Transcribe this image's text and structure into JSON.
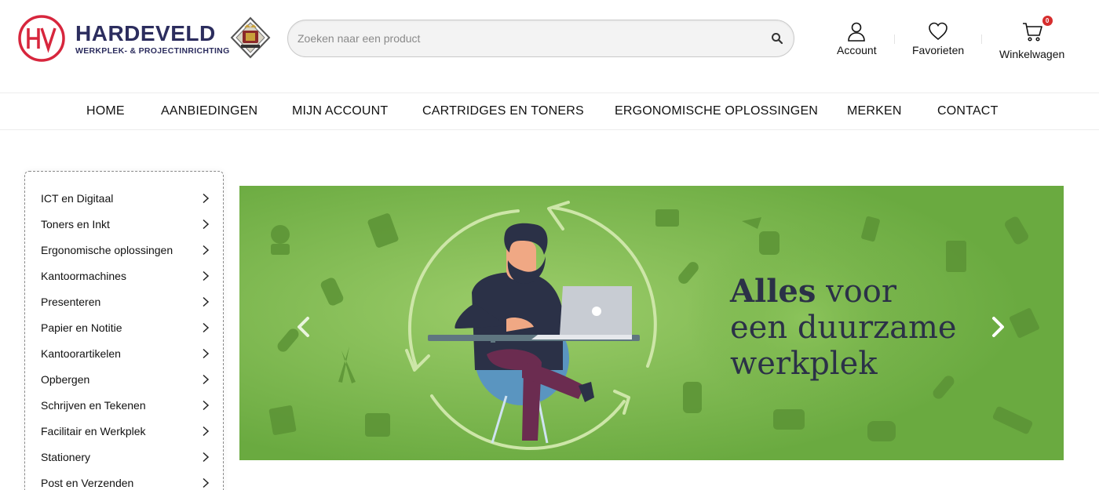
{
  "brand": {
    "name": "HARDEVELD",
    "tagline": "WERKPLEK- & PROJECTINRICHTING",
    "monogram": "HV",
    "color": "#2c2d5e",
    "accent": "#d7263d"
  },
  "search": {
    "placeholder": "Zoeken naar een product",
    "icon": "search-icon"
  },
  "header_actions": {
    "account": "Account",
    "favorites": "Favorieten",
    "cart": "Winkelwagen",
    "cart_count": "0"
  },
  "nav": [
    "HOME",
    "AANBIEDINGEN",
    "MIJN ACCOUNT",
    "CARTRIDGES EN TONERS",
    "ERGONOMISCHE OPLOSSINGEN",
    "MERKEN",
    "CONTACT"
  ],
  "categories": [
    "ICT en Digitaal",
    "Toners en Inkt",
    "Ergonomische oplossingen",
    "Kantoormachines",
    "Presenteren",
    "Papier en Notitie",
    "Kantoorartikelen",
    "Opbergen",
    "Schrijven en Tekenen",
    "Facilitair en Werkplek",
    "Stationery",
    "Post en Verzenden"
  ],
  "banner": {
    "bold": "Alles",
    "line1_rest": " voor",
    "line2": "een duurzame",
    "line3": "werkplek",
    "background": "#6fae43",
    "text_color": "#2b3147"
  }
}
